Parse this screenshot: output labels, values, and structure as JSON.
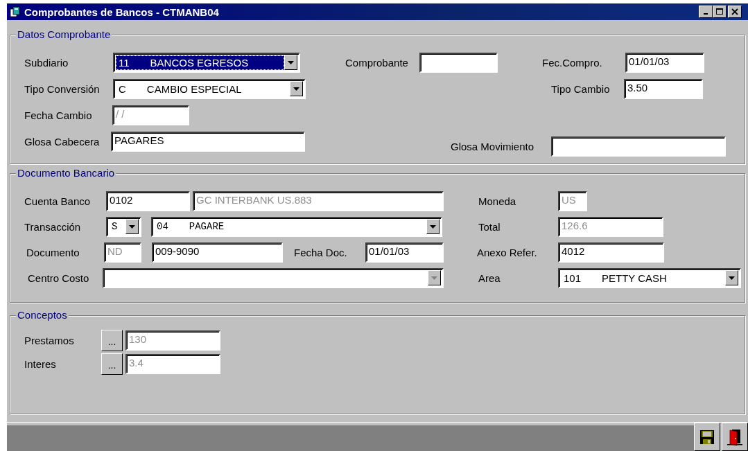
{
  "window": {
    "title": "Comprobantes de Bancos - CTMANB04"
  },
  "groups": [
    {
      "title": "Datos Comprobante",
      "rows": [
        [
          {
            "kind": "label",
            "text": "Subdiario"
          },
          {
            "kind": "combo",
            "code": "11",
            "text": "BANCOS EGRESOS",
            "highlighted": true,
            "disabled": false
          },
          {
            "kind": "label",
            "text": "Comprobante"
          },
          {
            "kind": "field"
          },
          {
            "kind": "label",
            "text": "Fec.Compro."
          },
          {
            "kind": "field",
            "value": "01/01/03",
            "disabled": false
          }
        ],
        [
          {
            "kind": "label",
            "text": "Tipo Conversión"
          },
          {
            "kind": "combo",
            "code": "C",
            "text": "CAMBIO ESPECIAL",
            "highlighted": false,
            "disabled": false
          },
          "",
          "",
          {
            "kind": "label",
            "text": "Tipo Cambio"
          },
          {
            "kind": "field",
            "value": "3.50",
            "disabled": false
          }
        ],
        [
          {
            "kind": "label",
            "text": "Fecha Cambio"
          },
          {
            "kind": "field",
            "value": "/ /",
            "disabled": true
          }
        ],
        [
          {
            "kind": "label",
            "text": "Glosa Cabecera"
          },
          {
            "kind": "field",
            "value": "PAGARES",
            "disabled": false
          },
          {
            "kind": "label",
            "text": "Glosa Movimiento"
          },
          {
            "kind": "field"
          }
        ]
      ]
    },
    {
      "title": "Documento Bancario",
      "rows": [
        [
          {
            "kind": "label",
            "text": "Cuenta Banco"
          },
          {
            "kind": "field",
            "value": "0102",
            "disabled": false
          },
          {
            "kind": "field",
            "value": "GC  INTERBANK US.883",
            "disabled": true
          },
          {
            "kind": "label",
            "text": "Moneda"
          },
          {
            "kind": "field",
            "value": "US",
            "disabled": true
          }
        ],
        [
          {
            "kind": "label",
            "text": "Transacción"
          },
          {
            "kind": "combo",
            "code": "S",
            "highlighted": false,
            "disabled": false
          },
          {
            "kind": "combo",
            "code": "04",
            "text": "PAGARE",
            "highlighted": false,
            "disabled": false
          },
          {
            "kind": "label",
            "text": "Total"
          },
          {
            "kind": "field",
            "value": "126.6",
            "disabled": true
          }
        ],
        [
          {
            "kind": "label",
            "text": "Documento"
          },
          {
            "kind": "field",
            "value": "ND",
            "disabled": true
          },
          {
            "kind": "field",
            "value": "009-9090",
            "disabled": false
          },
          {
            "kind": "label",
            "text": "Fecha Doc."
          },
          {
            "kind": "field",
            "value": "01/01/03",
            "disabled": false
          },
          {
            "kind": "label",
            "text": "Anexo Refer."
          },
          {
            "kind": "field",
            "value": "4012",
            "disabled": false
          }
        ],
        [
          {
            "kind": "label",
            "text": "Centro Costo"
          },
          {
            "kind": "combo",
            "highlighted": false,
            "disabled": true
          },
          "",
          {
            "kind": "label",
            "text": "Area"
          },
          {
            "kind": "combo",
            "code": "101",
            "text": "PETTY CASH",
            "highlighted": false,
            "disabled": false
          }
        ]
      ]
    },
    {
      "title": "Conceptos",
      "rows": [
        [
          {
            "kind": "label",
            "text": "Prestamos"
          },
          {
            "kind": "button",
            "text": "..."
          },
          {
            "kind": "field",
            "value": "130",
            "disabled": true
          }
        ],
        [
          {
            "kind": "label",
            "text": "Interes"
          },
          {
            "kind": "button",
            "text": "..."
          },
          {
            "kind": "field",
            "value": "3.4",
            "disabled": true
          }
        ]
      ]
    }
  ],
  "toolbar": {
    "buttons": [
      {
        "kind": "save"
      },
      {
        "kind": "exit"
      }
    ]
  }
}
